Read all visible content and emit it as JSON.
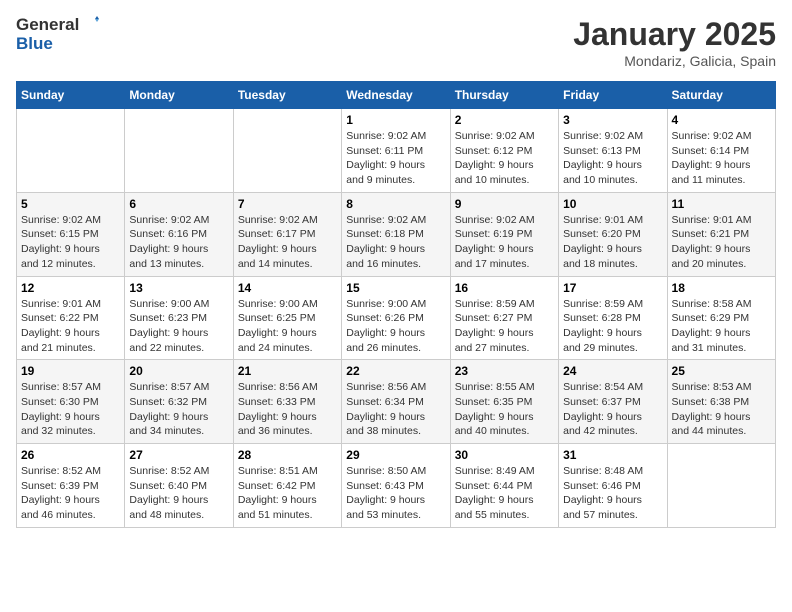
{
  "header": {
    "logo": {
      "general": "General",
      "blue": "Blue"
    },
    "title": "January 2025",
    "location": "Mondariz, Galicia, Spain"
  },
  "calendar": {
    "weekdays": [
      "Sunday",
      "Monday",
      "Tuesday",
      "Wednesday",
      "Thursday",
      "Friday",
      "Saturday"
    ],
    "weeks": [
      [
        {
          "day": "",
          "info": ""
        },
        {
          "day": "",
          "info": ""
        },
        {
          "day": "",
          "info": ""
        },
        {
          "day": "1",
          "info": "Sunrise: 9:02 AM\nSunset: 6:11 PM\nDaylight: 9 hours\nand 9 minutes."
        },
        {
          "day": "2",
          "info": "Sunrise: 9:02 AM\nSunset: 6:12 PM\nDaylight: 9 hours\nand 10 minutes."
        },
        {
          "day": "3",
          "info": "Sunrise: 9:02 AM\nSunset: 6:13 PM\nDaylight: 9 hours\nand 10 minutes."
        },
        {
          "day": "4",
          "info": "Sunrise: 9:02 AM\nSunset: 6:14 PM\nDaylight: 9 hours\nand 11 minutes."
        }
      ],
      [
        {
          "day": "5",
          "info": "Sunrise: 9:02 AM\nSunset: 6:15 PM\nDaylight: 9 hours\nand 12 minutes."
        },
        {
          "day": "6",
          "info": "Sunrise: 9:02 AM\nSunset: 6:16 PM\nDaylight: 9 hours\nand 13 minutes."
        },
        {
          "day": "7",
          "info": "Sunrise: 9:02 AM\nSunset: 6:17 PM\nDaylight: 9 hours\nand 14 minutes."
        },
        {
          "day": "8",
          "info": "Sunrise: 9:02 AM\nSunset: 6:18 PM\nDaylight: 9 hours\nand 16 minutes."
        },
        {
          "day": "9",
          "info": "Sunrise: 9:02 AM\nSunset: 6:19 PM\nDaylight: 9 hours\nand 17 minutes."
        },
        {
          "day": "10",
          "info": "Sunrise: 9:01 AM\nSunset: 6:20 PM\nDaylight: 9 hours\nand 18 minutes."
        },
        {
          "day": "11",
          "info": "Sunrise: 9:01 AM\nSunset: 6:21 PM\nDaylight: 9 hours\nand 20 minutes."
        }
      ],
      [
        {
          "day": "12",
          "info": "Sunrise: 9:01 AM\nSunset: 6:22 PM\nDaylight: 9 hours\nand 21 minutes."
        },
        {
          "day": "13",
          "info": "Sunrise: 9:00 AM\nSunset: 6:23 PM\nDaylight: 9 hours\nand 22 minutes."
        },
        {
          "day": "14",
          "info": "Sunrise: 9:00 AM\nSunset: 6:25 PM\nDaylight: 9 hours\nand 24 minutes."
        },
        {
          "day": "15",
          "info": "Sunrise: 9:00 AM\nSunset: 6:26 PM\nDaylight: 9 hours\nand 26 minutes."
        },
        {
          "day": "16",
          "info": "Sunrise: 8:59 AM\nSunset: 6:27 PM\nDaylight: 9 hours\nand 27 minutes."
        },
        {
          "day": "17",
          "info": "Sunrise: 8:59 AM\nSunset: 6:28 PM\nDaylight: 9 hours\nand 29 minutes."
        },
        {
          "day": "18",
          "info": "Sunrise: 8:58 AM\nSunset: 6:29 PM\nDaylight: 9 hours\nand 31 minutes."
        }
      ],
      [
        {
          "day": "19",
          "info": "Sunrise: 8:57 AM\nSunset: 6:30 PM\nDaylight: 9 hours\nand 32 minutes."
        },
        {
          "day": "20",
          "info": "Sunrise: 8:57 AM\nSunset: 6:32 PM\nDaylight: 9 hours\nand 34 minutes."
        },
        {
          "day": "21",
          "info": "Sunrise: 8:56 AM\nSunset: 6:33 PM\nDaylight: 9 hours\nand 36 minutes."
        },
        {
          "day": "22",
          "info": "Sunrise: 8:56 AM\nSunset: 6:34 PM\nDaylight: 9 hours\nand 38 minutes."
        },
        {
          "day": "23",
          "info": "Sunrise: 8:55 AM\nSunset: 6:35 PM\nDaylight: 9 hours\nand 40 minutes."
        },
        {
          "day": "24",
          "info": "Sunrise: 8:54 AM\nSunset: 6:37 PM\nDaylight: 9 hours\nand 42 minutes."
        },
        {
          "day": "25",
          "info": "Sunrise: 8:53 AM\nSunset: 6:38 PM\nDaylight: 9 hours\nand 44 minutes."
        }
      ],
      [
        {
          "day": "26",
          "info": "Sunrise: 8:52 AM\nSunset: 6:39 PM\nDaylight: 9 hours\nand 46 minutes."
        },
        {
          "day": "27",
          "info": "Sunrise: 8:52 AM\nSunset: 6:40 PM\nDaylight: 9 hours\nand 48 minutes."
        },
        {
          "day": "28",
          "info": "Sunrise: 8:51 AM\nSunset: 6:42 PM\nDaylight: 9 hours\nand 51 minutes."
        },
        {
          "day": "29",
          "info": "Sunrise: 8:50 AM\nSunset: 6:43 PM\nDaylight: 9 hours\nand 53 minutes."
        },
        {
          "day": "30",
          "info": "Sunrise: 8:49 AM\nSunset: 6:44 PM\nDaylight: 9 hours\nand 55 minutes."
        },
        {
          "day": "31",
          "info": "Sunrise: 8:48 AM\nSunset: 6:46 PM\nDaylight: 9 hours\nand 57 minutes."
        },
        {
          "day": "",
          "info": ""
        }
      ]
    ]
  }
}
